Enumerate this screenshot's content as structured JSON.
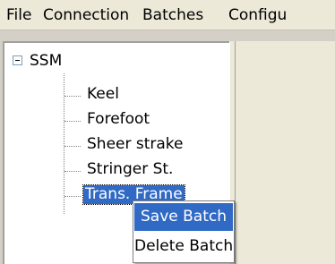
{
  "menubar": {
    "items": [
      "File",
      "Connection",
      "Batches",
      "Configu"
    ]
  },
  "tree": {
    "root_label": "SSM",
    "children": [
      "Keel",
      "Forefoot",
      "Sheer strake",
      "Stringer St.",
      "Trans. Frame"
    ]
  },
  "context_menu": {
    "items": [
      "Save Batch",
      "Delete Batch"
    ]
  },
  "colors": {
    "selection": "#316ac5",
    "menubar_bg": "#ece9d8",
    "tree_bg": "#ffffff"
  }
}
